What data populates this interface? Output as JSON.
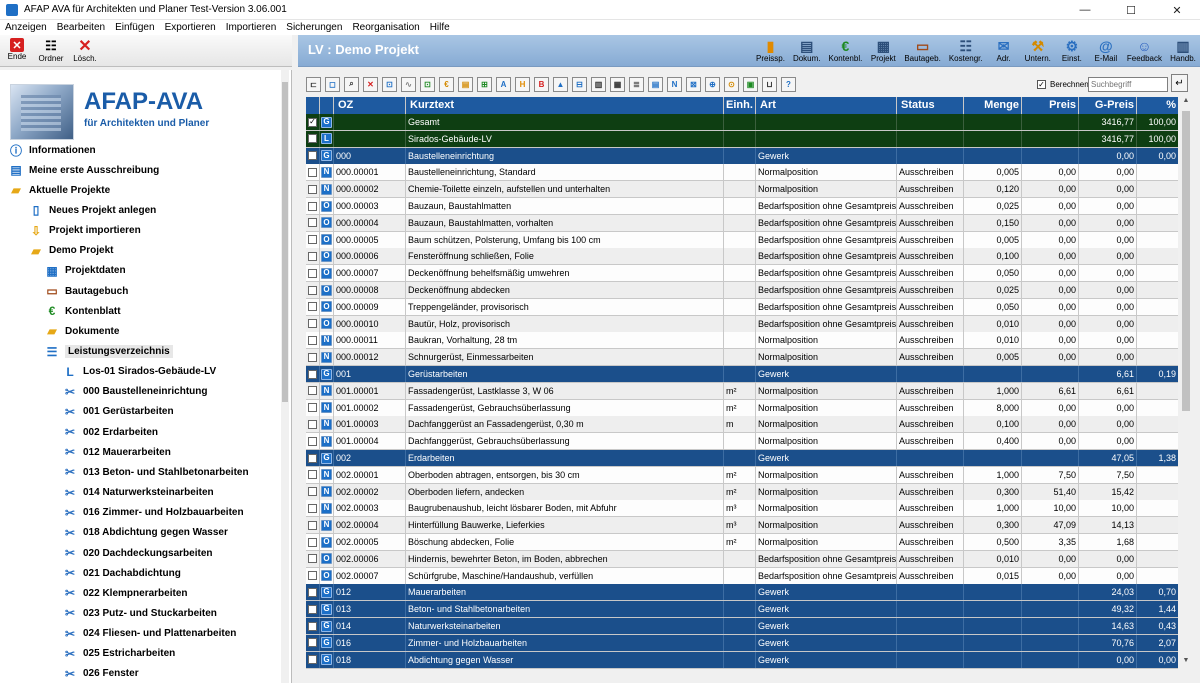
{
  "window": {
    "title": "AFAP AVA für Architekten und Planer Test-Version 3.06.001"
  },
  "menu": [
    "Anzeigen",
    "Bearbeiten",
    "Einfügen",
    "Exportieren",
    "Importieren",
    "Sicherungen",
    "Reorganisation",
    "Hilfe"
  ],
  "left_toolbar": [
    {
      "label": "Ende",
      "icon": "close-red-icon"
    },
    {
      "label": "Ordner",
      "icon": "tree-icon"
    },
    {
      "label": "Lösch.",
      "icon": "delete-x-icon"
    }
  ],
  "header": {
    "title": "LV : Demo Projekt"
  },
  "right_toolbar": [
    {
      "label": "Preissp.",
      "icon": "bar-chart-icon"
    },
    {
      "label": "Dokum.",
      "icon": "document-icon"
    },
    {
      "label": "Kontenbl.",
      "icon": "euro-icon"
    },
    {
      "label": "Projekt",
      "icon": "building-icon"
    },
    {
      "label": "Bautageb.",
      "icon": "book-icon"
    },
    {
      "label": "Kostengr.",
      "icon": "hierarchy-icon"
    },
    {
      "label": "Adr.",
      "icon": "mail-icon"
    },
    {
      "label": "Untern.",
      "icon": "crane-icon"
    },
    {
      "label": "Einst.",
      "icon": "gear-icon"
    },
    {
      "label": "E-Mail",
      "icon": "at-icon"
    },
    {
      "label": "Feedback",
      "icon": "feedback-icon"
    },
    {
      "label": "Handb.",
      "icon": "handbook-icon"
    }
  ],
  "logo": {
    "brand": "AFAP-AVA",
    "subtitle": "für Architekten und Planer"
  },
  "tree": [
    {
      "label": "Informationen",
      "icon": "info-icon",
      "level": 0
    },
    {
      "label": "Meine erste Ausschreibung",
      "icon": "list-doc-icon",
      "level": 0
    },
    {
      "label": "Aktuelle Projekte",
      "icon": "folder-open-icon",
      "level": 0
    },
    {
      "label": "Neues Projekt anlegen",
      "icon": "new-doc-icon",
      "level": 1
    },
    {
      "label": "Projekt importieren",
      "icon": "import-icon",
      "level": 1
    },
    {
      "label": "Demo Projekt",
      "icon": "folder-open-icon",
      "level": 1
    },
    {
      "label": "Projektdaten",
      "icon": "building-icon",
      "level": 2
    },
    {
      "label": "Bautagebuch",
      "icon": "book-icon",
      "level": 2
    },
    {
      "label": "Kontenblatt",
      "icon": "euro-icon",
      "level": 2
    },
    {
      "label": "Dokumente",
      "icon": "folder-open-icon",
      "level": 2
    },
    {
      "label": "Leistungsverzeichnis",
      "icon": "list-icon",
      "level": 2,
      "selected": true
    },
    {
      "label": "Los-01  Sirados-Gebäude-LV",
      "icon": "los-icon",
      "level": 3
    },
    {
      "label": "000 Baustelleneinrichtung",
      "icon": "tools-icon",
      "level": 3
    },
    {
      "label": "001 Gerüstarbeiten",
      "icon": "tools-icon",
      "level": 3
    },
    {
      "label": "002 Erdarbeiten",
      "icon": "tools-icon",
      "level": 3
    },
    {
      "label": "012 Mauerarbeiten",
      "icon": "tools-icon",
      "level": 3
    },
    {
      "label": "013 Beton- und Stahlbetonarbeiten",
      "icon": "tools-icon",
      "level": 3
    },
    {
      "label": "014 Naturwerksteinarbeiten",
      "icon": "tools-icon",
      "level": 3
    },
    {
      "label": "016 Zimmer- und Holzbauarbeiten",
      "icon": "tools-icon",
      "level": 3
    },
    {
      "label": "018 Abdichtung gegen Wasser",
      "icon": "tools-icon",
      "level": 3
    },
    {
      "label": "020 Dachdeckungsarbeiten",
      "icon": "tools-icon",
      "level": 3
    },
    {
      "label": "021 Dachabdichtung",
      "icon": "tools-icon",
      "level": 3
    },
    {
      "label": "022 Klempnerarbeiten",
      "icon": "tools-icon",
      "level": 3
    },
    {
      "label": "023 Putz- und Stuckarbeiten",
      "icon": "tools-icon",
      "level": 3
    },
    {
      "label": "024 Fliesen- und Plattenarbeiten",
      "icon": "tools-icon",
      "level": 3
    },
    {
      "label": "025 Estricharbeiten",
      "icon": "tools-icon",
      "level": 3
    },
    {
      "label": "026 Fenster",
      "icon": "tools-icon",
      "level": 3
    }
  ],
  "grid_toolbar": [
    "⊏",
    "◻",
    "⌕",
    "✕",
    "⊡",
    "∿",
    "⊡",
    "€",
    "▤",
    "⊞",
    "A",
    "H",
    "B",
    "▲",
    "⊟",
    "▥",
    "▦",
    "≣",
    "▤",
    "N",
    "⊠",
    "⊕",
    "⊙",
    "▣",
    "⊔",
    "?"
  ],
  "search": {
    "berechnen_label": "Berechnen",
    "placeholder": "Suchbegriff"
  },
  "columns": [
    "",
    "",
    "OZ",
    "Kurztext",
    "Einh.",
    "Art",
    "Status",
    "Menge",
    "Preis",
    "G-Preis",
    "%"
  ],
  "rows": [
    {
      "kind": "gesamt",
      "checked": true,
      "t": "G",
      "oz": "",
      "text": "Gesamt",
      "einh": "",
      "art": "",
      "status": "",
      "menge": "",
      "preis": "",
      "gpreis": "3416,77",
      "pct": "100,00"
    },
    {
      "kind": "gesamt",
      "checked": false,
      "t": "L",
      "oz": "",
      "text": "Sirados-Gebäude-LV",
      "einh": "",
      "art": "",
      "status": "",
      "menge": "",
      "preis": "",
      "gpreis": "3416,77",
      "pct": "100,00"
    },
    {
      "kind": "gewerk",
      "checked": false,
      "t": "G",
      "oz": "000",
      "text": "Baustelleneinrichtung",
      "einh": "",
      "art": "Gewerk",
      "status": "",
      "menge": "",
      "preis": "",
      "gpreis": "0,00",
      "pct": "0,00"
    },
    {
      "kind": "item",
      "checked": false,
      "t": "N",
      "oz": "000.00001",
      "text": "Baustelleneinrichtung, Standard",
      "einh": "",
      "art": "Normalposition",
      "status": "Ausschreiben",
      "menge": "0,005",
      "preis": "0,00",
      "gpreis": "0,00",
      "pct": ""
    },
    {
      "kind": "item",
      "checked": false,
      "t": "N",
      "oz": "000.00002",
      "text": "Chemie-Toilette einzeln, aufstellen und unterhalten",
      "einh": "",
      "art": "Normalposition",
      "status": "Ausschreiben",
      "menge": "0,120",
      "preis": "0,00",
      "gpreis": "0,00",
      "pct": ""
    },
    {
      "kind": "item",
      "checked": false,
      "t": "O",
      "oz": "000.00003",
      "text": "Bauzaun, Baustahlmatten",
      "einh": "",
      "art": "Bedarfsposition ohne Gesamtpreis",
      "status": "Ausschreiben",
      "menge": "0,025",
      "preis": "0,00",
      "gpreis": "0,00",
      "pct": ""
    },
    {
      "kind": "item",
      "checked": false,
      "t": "O",
      "oz": "000.00004",
      "text": "Bauzaun, Baustahlmatten, vorhalten",
      "einh": "",
      "art": "Bedarfsposition ohne Gesamtpreis",
      "status": "Ausschreiben",
      "menge": "0,150",
      "preis": "0,00",
      "gpreis": "0,00",
      "pct": ""
    },
    {
      "kind": "item",
      "checked": false,
      "t": "O",
      "oz": "000.00005",
      "text": "Baum schützen, Polsterung, Umfang  bis 100 cm",
      "einh": "",
      "art": "Bedarfsposition ohne Gesamtpreis",
      "status": "Ausschreiben",
      "menge": "0,005",
      "preis": "0,00",
      "gpreis": "0,00",
      "pct": ""
    },
    {
      "kind": "item",
      "checked": false,
      "t": "O",
      "oz": "000.00006",
      "text": "Fensteröffnung schließen, Folie",
      "einh": "",
      "art": "Bedarfsposition ohne Gesamtpreis",
      "status": "Ausschreiben",
      "menge": "0,100",
      "preis": "0,00",
      "gpreis": "0,00",
      "pct": ""
    },
    {
      "kind": "item",
      "checked": false,
      "t": "O",
      "oz": "000.00007",
      "text": "Deckenöffnung behelfsmäßig umwehren",
      "einh": "",
      "art": "Bedarfsposition ohne Gesamtpreis",
      "status": "Ausschreiben",
      "menge": "0,050",
      "preis": "0,00",
      "gpreis": "0,00",
      "pct": ""
    },
    {
      "kind": "item",
      "checked": false,
      "t": "O",
      "oz": "000.00008",
      "text": "Deckenöffnung abdecken",
      "einh": "",
      "art": "Bedarfsposition ohne Gesamtpreis",
      "status": "Ausschreiben",
      "menge": "0,025",
      "preis": "0,00",
      "gpreis": "0,00",
      "pct": ""
    },
    {
      "kind": "item",
      "checked": false,
      "t": "O",
      "oz": "000.00009",
      "text": "Treppengeländer, provisorisch",
      "einh": "",
      "art": "Bedarfsposition ohne Gesamtpreis",
      "status": "Ausschreiben",
      "menge": "0,050",
      "preis": "0,00",
      "gpreis": "0,00",
      "pct": ""
    },
    {
      "kind": "item",
      "checked": false,
      "t": "O",
      "oz": "000.00010",
      "text": "Bautür, Holz, provisorisch",
      "einh": "",
      "art": "Bedarfsposition ohne Gesamtpreis",
      "status": "Ausschreiben",
      "menge": "0,010",
      "preis": "0,00",
      "gpreis": "0,00",
      "pct": ""
    },
    {
      "kind": "item",
      "checked": false,
      "t": "N",
      "oz": "000.00011",
      "text": "Baukran, Vorhaltung, 28 tm",
      "einh": "",
      "art": "Normalposition",
      "status": "Ausschreiben",
      "menge": "0,010",
      "preis": "0,00",
      "gpreis": "0,00",
      "pct": ""
    },
    {
      "kind": "item",
      "checked": false,
      "t": "N",
      "oz": "000.00012",
      "text": "Schnurgerüst, Einmessarbeiten",
      "einh": "",
      "art": "Normalposition",
      "status": "Ausschreiben",
      "menge": "0,005",
      "preis": "0,00",
      "gpreis": "0,00",
      "pct": ""
    },
    {
      "kind": "gewerk",
      "checked": false,
      "t": "G",
      "oz": "001",
      "text": "Gerüstarbeiten",
      "einh": "",
      "art": "Gewerk",
      "status": "",
      "menge": "",
      "preis": "",
      "gpreis": "6,61",
      "pct": "0,19"
    },
    {
      "kind": "item",
      "checked": false,
      "t": "N",
      "oz": "001.00001",
      "text": "Fassadengerüst, Lastklasse 3, W 06",
      "einh": "m²",
      "art": "Normalposition",
      "status": "Ausschreiben",
      "menge": "1,000",
      "preis": "6,61",
      "gpreis": "6,61",
      "pct": ""
    },
    {
      "kind": "item",
      "checked": false,
      "t": "N",
      "oz": "001.00002",
      "text": "Fassadengerüst, Gebrauchsüberlassung",
      "einh": "m²",
      "art": "Normalposition",
      "status": "Ausschreiben",
      "menge": "8,000",
      "preis": "0,00",
      "gpreis": "0,00",
      "pct": ""
    },
    {
      "kind": "item",
      "checked": false,
      "t": "N",
      "oz": "001.00003",
      "text": "Dachfanggerüst an Fassadengerüst, 0,30 m",
      "einh": "m",
      "art": "Normalposition",
      "status": "Ausschreiben",
      "menge": "0,100",
      "preis": "0,00",
      "gpreis": "0,00",
      "pct": ""
    },
    {
      "kind": "item",
      "checked": false,
      "t": "N",
      "oz": "001.00004",
      "text": "Dachfanggerüst, Gebrauchsüberlassung",
      "einh": "",
      "art": "Normalposition",
      "status": "Ausschreiben",
      "menge": "0,400",
      "preis": "0,00",
      "gpreis": "0,00",
      "pct": ""
    },
    {
      "kind": "gewerk",
      "checked": false,
      "t": "G",
      "oz": "002",
      "text": "Erdarbeiten",
      "einh": "",
      "art": "Gewerk",
      "status": "",
      "menge": "",
      "preis": "",
      "gpreis": "47,05",
      "pct": "1,38"
    },
    {
      "kind": "item",
      "checked": false,
      "t": "N",
      "oz": "002.00001",
      "text": "Oberboden abtragen, entsorgen, bis 30 cm",
      "einh": "m²",
      "art": "Normalposition",
      "status": "Ausschreiben",
      "menge": "1,000",
      "preis": "7,50",
      "gpreis": "7,50",
      "pct": ""
    },
    {
      "kind": "item",
      "checked": false,
      "t": "N",
      "oz": "002.00002",
      "text": "Oberboden liefern, andecken",
      "einh": "m²",
      "art": "Normalposition",
      "status": "Ausschreiben",
      "menge": "0,300",
      "preis": "51,40",
      "gpreis": "15,42",
      "pct": ""
    },
    {
      "kind": "item",
      "checked": false,
      "t": "N",
      "oz": "002.00003",
      "text": "Baugrubenaushub, leicht lösbarer Boden, mit Abfuhr",
      "einh": "m³",
      "art": "Normalposition",
      "status": "Ausschreiben",
      "menge": "1,000",
      "preis": "10,00",
      "gpreis": "10,00",
      "pct": ""
    },
    {
      "kind": "item",
      "checked": false,
      "t": "N",
      "oz": "002.00004",
      "text": "Hinterfüllung Bauwerke, Lieferkies",
      "einh": "m³",
      "art": "Normalposition",
      "status": "Ausschreiben",
      "menge": "0,300",
      "preis": "47,09",
      "gpreis": "14,13",
      "pct": ""
    },
    {
      "kind": "item",
      "checked": false,
      "t": "O",
      "oz": "002.00005",
      "text": "Böschung abdecken, Folie",
      "einh": "m²",
      "art": "Normalposition",
      "status": "Ausschreiben",
      "menge": "0,500",
      "preis": "3,35",
      "gpreis": "1,68",
      "pct": ""
    },
    {
      "kind": "item",
      "checked": false,
      "t": "O",
      "oz": "002.00006",
      "text": "Hindernis, bewehrter Beton, im Boden, abbrechen",
      "einh": "",
      "art": "Bedarfsposition ohne Gesamtpreis",
      "status": "Ausschreiben",
      "menge": "0,010",
      "preis": "0,00",
      "gpreis": "0,00",
      "pct": ""
    },
    {
      "kind": "item",
      "checked": false,
      "t": "O",
      "oz": "002.00007",
      "text": "Schürfgrube, Maschine/Handaushub, verfüllen",
      "einh": "",
      "art": "Bedarfsposition ohne Gesamtpreis",
      "status": "Ausschreiben",
      "menge": "0,015",
      "preis": "0,00",
      "gpreis": "0,00",
      "pct": ""
    },
    {
      "kind": "gewerk",
      "checked": false,
      "t": "G",
      "oz": "012",
      "text": "Mauerarbeiten",
      "einh": "",
      "art": "Gewerk",
      "status": "",
      "menge": "",
      "preis": "",
      "gpreis": "24,03",
      "pct": "0,70"
    },
    {
      "kind": "gewerk",
      "checked": false,
      "t": "G",
      "oz": "013",
      "text": "Beton- und Stahlbetonarbeiten",
      "einh": "",
      "art": "Gewerk",
      "status": "",
      "menge": "",
      "preis": "",
      "gpreis": "49,32",
      "pct": "1,44"
    },
    {
      "kind": "gewerk",
      "checked": false,
      "t": "G",
      "oz": "014",
      "text": "Naturwerksteinarbeiten",
      "einh": "",
      "art": "Gewerk",
      "status": "",
      "menge": "",
      "preis": "",
      "gpreis": "14,63",
      "pct": "0,43"
    },
    {
      "kind": "gewerk",
      "checked": false,
      "t": "G",
      "oz": "016",
      "text": "Zimmer- und Holzbauarbeiten",
      "einh": "",
      "art": "Gewerk",
      "status": "",
      "menge": "",
      "preis": "",
      "gpreis": "70,76",
      "pct": "2,07"
    },
    {
      "kind": "gewerk",
      "checked": false,
      "t": "G",
      "oz": "018",
      "text": "Abdichtung gegen Wasser",
      "einh": "",
      "art": "Gewerk",
      "status": "",
      "menge": "",
      "preis": "",
      "gpreis": "0,00",
      "pct": "0,00"
    }
  ],
  "colors": {
    "header_blue": "#1e5aa0",
    "gewerk_blue": "#1b4f8b",
    "gesamt_green": "#0e3e12",
    "brand_blue": "#1a5ca8"
  }
}
